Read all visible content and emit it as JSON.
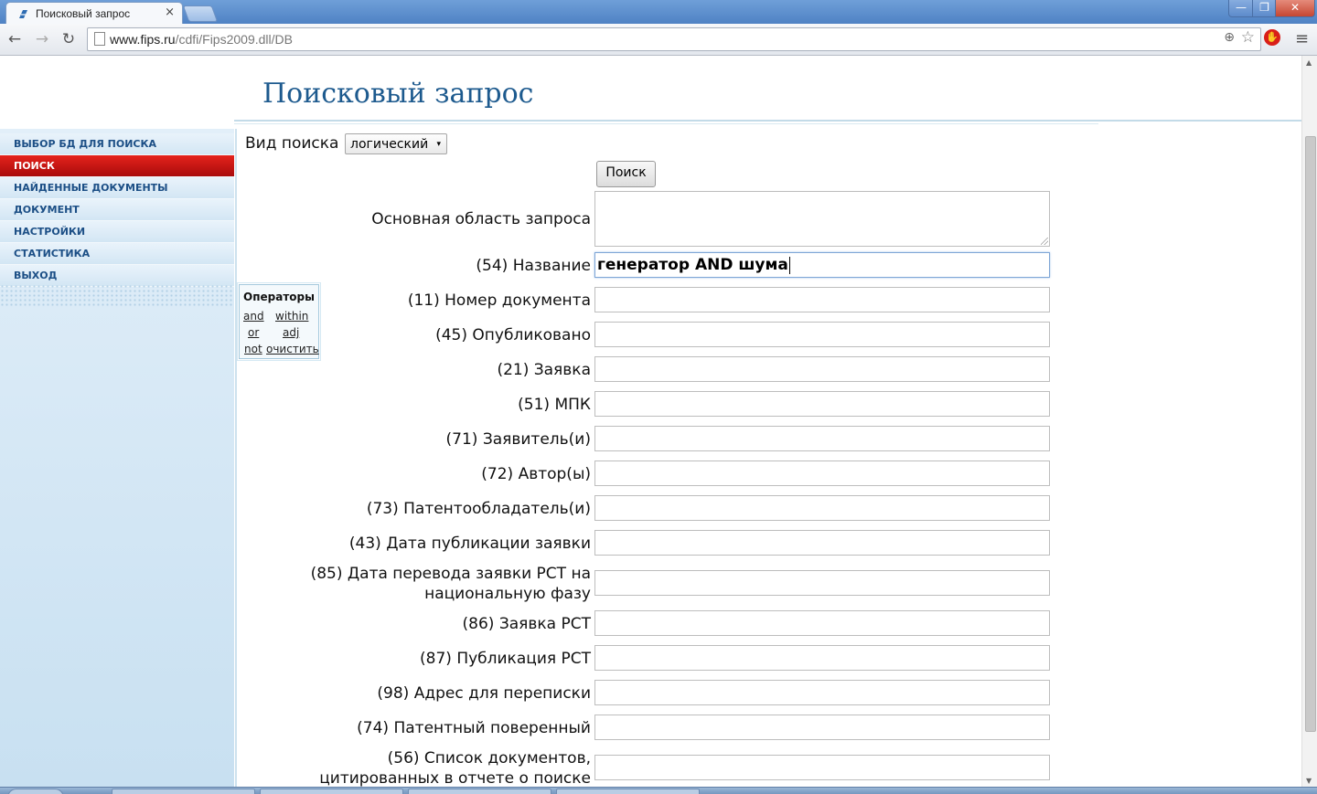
{
  "browser": {
    "tab_title": "Поисковый запрос",
    "tab_close": "×",
    "url_host": "www.fips.ru",
    "url_path": "/cdfi/Fips2009.dll/DB",
    "back_icon": "←",
    "forward_icon": "→",
    "reload_icon": "↻",
    "zoom_icon": "⊕",
    "star_icon": "☆",
    "menu_icon": "≡",
    "minimize": "—",
    "maximize": "❐",
    "close": "✕"
  },
  "page": {
    "title": "Поисковый запрос"
  },
  "sidebar": {
    "items": [
      {
        "label": "ВЫБОР БД ДЛЯ ПОИСКА",
        "active": false
      },
      {
        "label": "ПОИСК",
        "active": true
      },
      {
        "label": "НАЙДЕННЫЕ ДОКУМЕНТЫ",
        "active": false
      },
      {
        "label": "ДОКУМЕНТ",
        "active": false
      },
      {
        "label": "НАСТРОЙКИ",
        "active": false
      },
      {
        "label": "СТАТИСТИКА",
        "active": false
      },
      {
        "label": "ВЫХОД",
        "active": false
      }
    ]
  },
  "search": {
    "type_label": "Вид поиска",
    "type_value": "логический",
    "type_caret": "▾",
    "button": "Поиск"
  },
  "operators": {
    "title": "Операторы",
    "and": "and",
    "within": "within",
    "or": "or",
    "adj": "adj",
    "not": "not",
    "clear": "очистить"
  },
  "fields": [
    {
      "label": "Основная область запроса",
      "value": ""
    },
    {
      "label": "(54) Название",
      "value": "генератор AND шума"
    },
    {
      "label": "(11) Номер документа",
      "value": ""
    },
    {
      "label": "(45) Опубликовано",
      "value": ""
    },
    {
      "label": "(21) Заявка",
      "value": ""
    },
    {
      "label": "(51) МПК",
      "value": ""
    },
    {
      "label": "(71) Заявитель(и)",
      "value": ""
    },
    {
      "label": "(72) Автор(ы)",
      "value": ""
    },
    {
      "label": "(73) Патентообладатель(и)",
      "value": ""
    },
    {
      "label": "(43) Дата публикации заявки",
      "value": ""
    },
    {
      "label_line1": "(85) Дата перевода заявки PCT на",
      "label_line2": "национальную фазу",
      "value": ""
    },
    {
      "label": "(86) Заявка PCT",
      "value": ""
    },
    {
      "label": "(87) Публикация PCT",
      "value": ""
    },
    {
      "label": "(98) Адрес для переписки",
      "value": ""
    },
    {
      "label": "(74) Патентный поверенный",
      "value": ""
    },
    {
      "label_line1": "(56) Список документов,",
      "label_line2": "цитированных в отчете о поиске",
      "value": ""
    }
  ]
}
